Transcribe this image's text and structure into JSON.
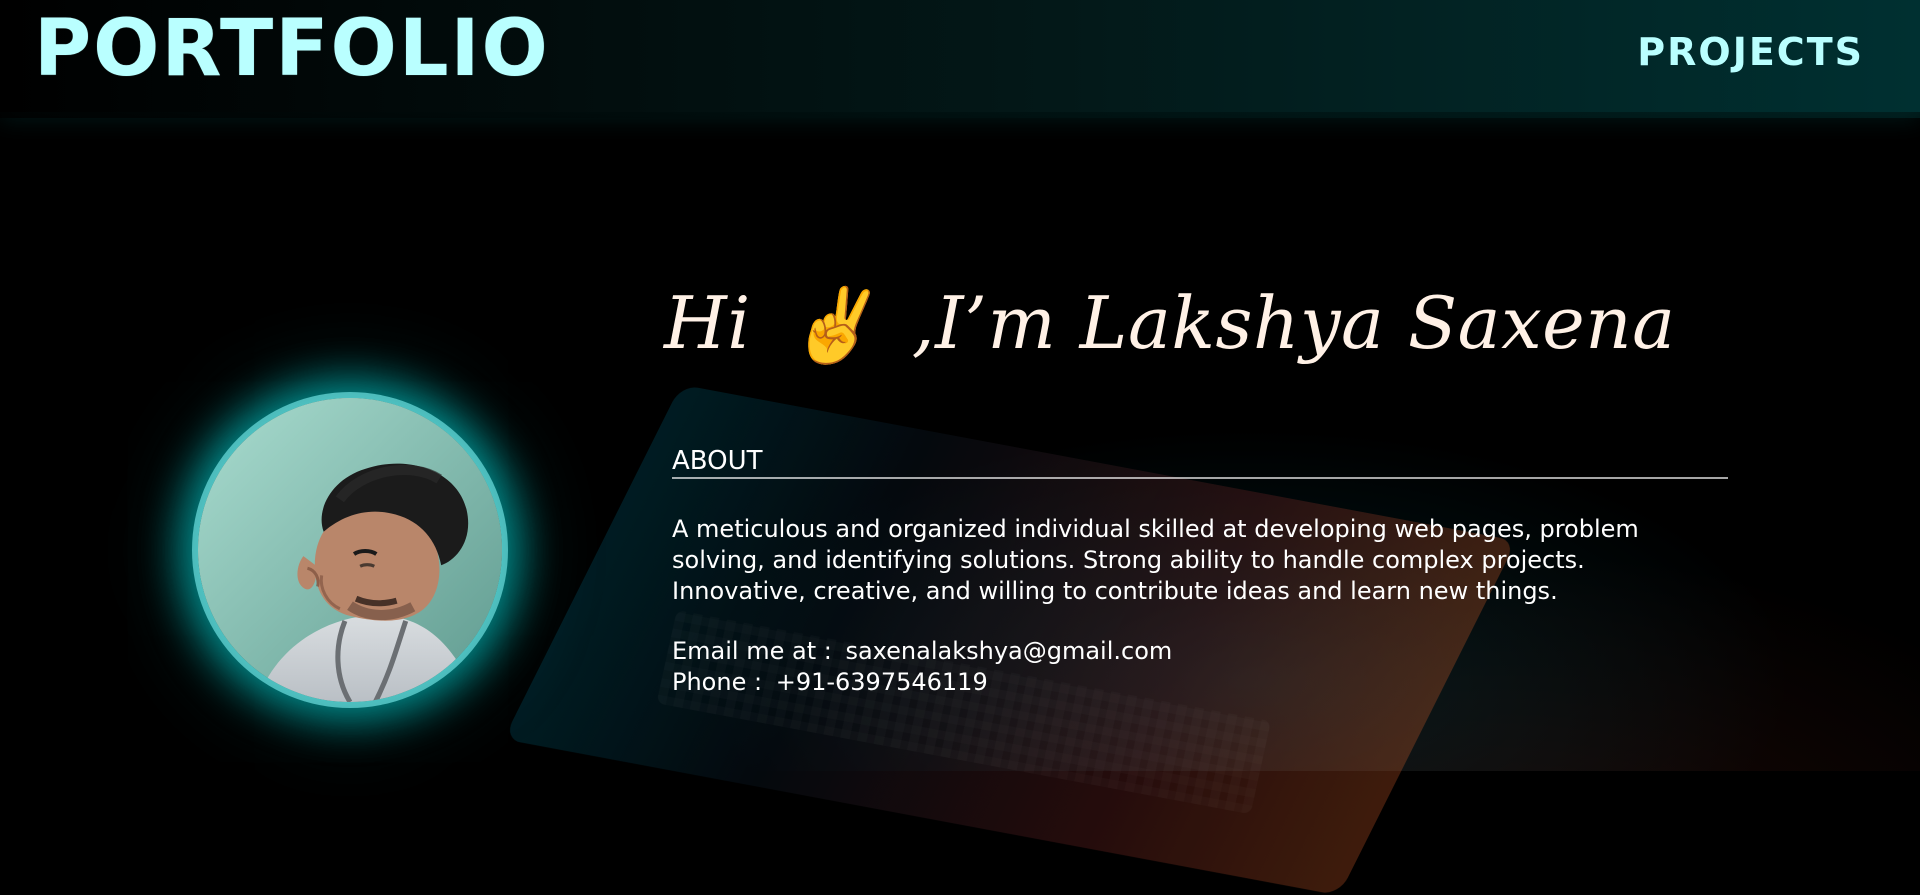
{
  "header": {
    "brand": "PORTFOLIO",
    "nav": {
      "projects": "PROJECTS"
    }
  },
  "hero": {
    "greeting_prefix": "Hi",
    "emoji": "✌️",
    "greeting_suffix": ",I’m Lakshya Saxena"
  },
  "about": {
    "title": "ABOUT",
    "paragraph": "A meticulous and organized individual skilled at developing web pages, problem solving, and identifying solutions. Strong ability to handle complex projects. Innovative, creative, and willing to contribute ideas and learn new things."
  },
  "contact": {
    "email_label": "Email me at :",
    "email": "saxenalakshya@gmail.com",
    "phone_label": "Phone :",
    "phone": "+91-6397546119"
  },
  "colors": {
    "accent": "#b9ffff",
    "text": "#ffffff",
    "greeting": "#fff1e6"
  }
}
